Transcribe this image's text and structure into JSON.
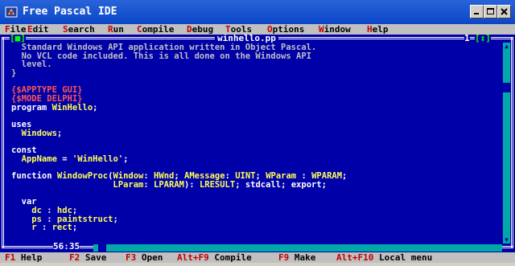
{
  "window": {
    "title": "Free Pascal IDE"
  },
  "menu": [
    {
      "hot": "F",
      "rest": "ile"
    },
    {
      "hot": "E",
      "rest": "dit"
    },
    {
      "hot": "S",
      "rest": "earch"
    },
    {
      "hot": "R",
      "rest": "un"
    },
    {
      "hot": "C",
      "rest": "ompile"
    },
    {
      "hot": "D",
      "rest": "ebug"
    },
    {
      "hot": "T",
      "rest": "ools"
    },
    {
      "hot": "O",
      "rest": "ptions"
    },
    {
      "hot": "W",
      "rest": "indow"
    },
    {
      "hot": "H",
      "rest": "elp"
    }
  ],
  "editor": {
    "close_box": "[■]",
    "file_name": "winhello.pp",
    "window_number": "1",
    "zoom_box": "[↕]",
    "cursor_pos": "56:35",
    "lines": [
      [
        [
          "c-com",
          "  Standard Windows API application written in Object Pascal."
        ]
      ],
      [
        [
          "c-com",
          "  No VCL code included. This is all done on the Windows API"
        ]
      ],
      [
        [
          "c-com",
          "  level."
        ]
      ],
      [
        [
          "c-com",
          "}"
        ]
      ],
      [
        [
          "c-com",
          ""
        ]
      ],
      [
        [
          "c-dir",
          "{$APPTYPE GUI}"
        ]
      ],
      [
        [
          "c-dir",
          "{$MODE DELPHI}"
        ]
      ],
      [
        [
          "c-kw",
          "program "
        ],
        [
          "c-id",
          "WinHello"
        ],
        [
          "c-kw",
          ";"
        ]
      ],
      [
        [
          "c-kw",
          ""
        ]
      ],
      [
        [
          "c-kw",
          "uses"
        ]
      ],
      [
        [
          "c-id",
          "  Windows"
        ],
        [
          "c-kw",
          ";"
        ]
      ],
      [
        [
          "c-kw",
          ""
        ]
      ],
      [
        [
          "c-kw",
          "const"
        ]
      ],
      [
        [
          "c-id",
          "  AppName "
        ],
        [
          "c-kw",
          "= "
        ],
        [
          "c-str",
          "'WinHello'"
        ],
        [
          "c-kw",
          ";"
        ]
      ],
      [
        [
          "c-kw",
          ""
        ]
      ],
      [
        [
          "c-kw",
          "function "
        ],
        [
          "c-id",
          "WindowProc"
        ],
        [
          "c-kw",
          "("
        ],
        [
          "c-id",
          "Window"
        ],
        [
          "c-kw",
          ": "
        ],
        [
          "c-id",
          "HWnd"
        ],
        [
          "c-kw",
          "; "
        ],
        [
          "c-id",
          "AMessage"
        ],
        [
          "c-kw",
          ": "
        ],
        [
          "c-id",
          "UINT"
        ],
        [
          "c-kw",
          "; "
        ],
        [
          "c-id",
          "WParam "
        ],
        [
          "c-kw",
          ": "
        ],
        [
          "c-id",
          "WPARAM"
        ],
        [
          "c-kw",
          ";"
        ]
      ],
      [
        [
          "c-id",
          "                    LParam"
        ],
        [
          "c-kw",
          ": "
        ],
        [
          "c-id",
          "LPARAM"
        ],
        [
          "c-kw",
          "): "
        ],
        [
          "c-id",
          "LRESULT"
        ],
        [
          "c-kw",
          "; stdcall; export;"
        ]
      ],
      [
        [
          "c-kw",
          ""
        ]
      ],
      [
        [
          "c-kw",
          "  var"
        ]
      ],
      [
        [
          "c-id",
          "    dc "
        ],
        [
          "c-kw",
          ": "
        ],
        [
          "c-id",
          "hdc"
        ],
        [
          "c-kw",
          ";"
        ]
      ],
      [
        [
          "c-id",
          "    ps "
        ],
        [
          "c-kw",
          ": "
        ],
        [
          "c-id",
          "paintstruct"
        ],
        [
          "c-kw",
          ";"
        ]
      ],
      [
        [
          "c-id",
          "    r "
        ],
        [
          "c-kw",
          ": "
        ],
        [
          "c-id",
          "rect"
        ],
        [
          "c-kw",
          ";"
        ]
      ]
    ]
  },
  "statusbar": [
    {
      "key": "F1",
      "label": " Help"
    },
    {
      "key": "F2",
      "label": " Save"
    },
    {
      "key": "F3",
      "label": " Open"
    },
    {
      "key": "Alt+F9",
      "label": " Compile"
    },
    {
      "key": "F9",
      "label": " Make"
    },
    {
      "key": "Alt+F10",
      "label": " Local menu"
    }
  ]
}
